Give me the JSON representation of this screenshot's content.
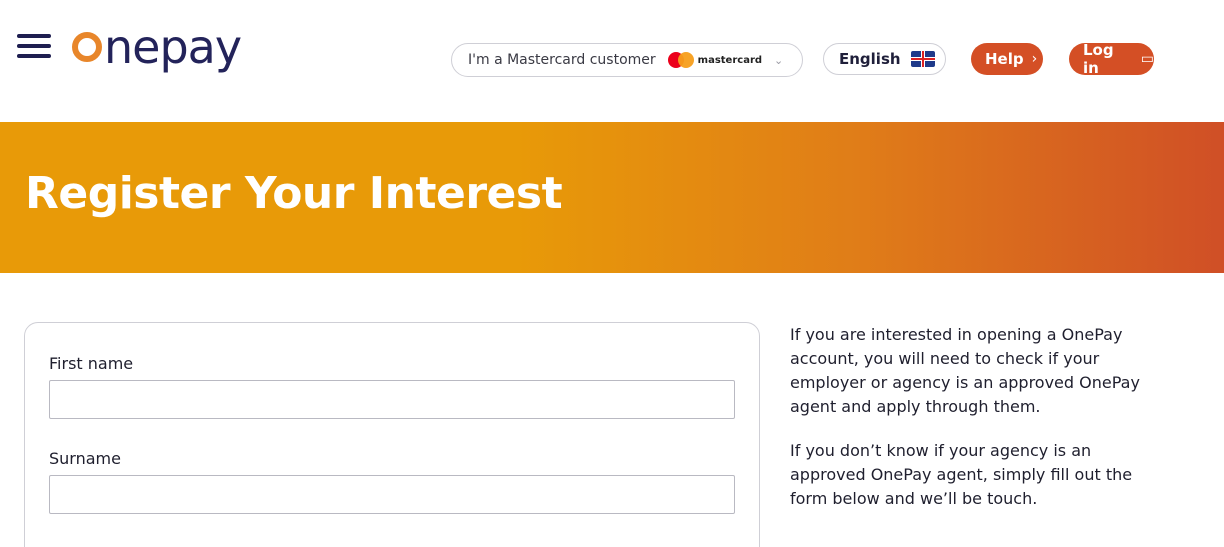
{
  "header": {
    "logo_text": "onepay",
    "mastercard_customer_label": "I'm a Mastercard customer",
    "mastercard_brand": "mastercard",
    "language_label": "English",
    "help_label": "Help",
    "login_label": "Log in"
  },
  "banner": {
    "title": "Register Your Interest"
  },
  "form": {
    "first_name_label": "First name",
    "first_name_value": "",
    "surname_label": "Surname",
    "surname_value": ""
  },
  "side": {
    "paragraph1": "If you are interested in opening a OnePay account, you will need to check if your employer or agency is an approved OnePay agent and apply through them.",
    "paragraph2": "If you don’t know if your agency is an approved OnePay agent, simply fill out the form below and we’ll be touch."
  },
  "colors": {
    "accent": "#d44f25",
    "banner_start": "#e89a08",
    "banner_end": "#d04f26",
    "navy": "#23235a",
    "logo_orange": "#e8862a"
  }
}
